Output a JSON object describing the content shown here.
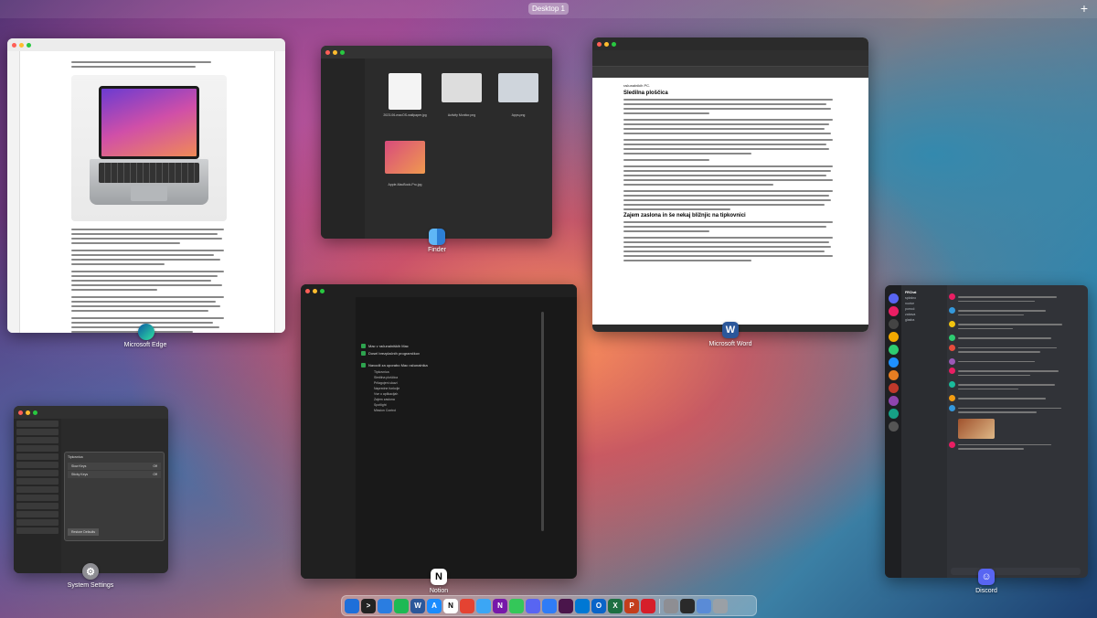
{
  "spaces": {
    "desktop_label": "Desktop 1",
    "add_symbol": "+"
  },
  "windows": {
    "edge": {
      "label": "Microsoft Edge",
      "icon": "edge-icon"
    },
    "finder": {
      "label": "Finder",
      "icon": "finder-icon",
      "files": [
        "2023-06-macOS-wallpaper.jpg",
        "Activity Monitor.png",
        "Apps.png",
        "Apple-MacBook-Pro.jpg"
      ]
    },
    "word": {
      "label": "Microsoft Word",
      "icon": "word-icon",
      "heading1": "Sledilna ploščica",
      "heading2": "Zajem zaslona in še nekaj bližnjic na tipkovnici",
      "heading1_prefix": "računalnikih PC."
    },
    "notion": {
      "label": "Notion",
      "icon": "notion-icon",
      "todos": [
        "Mac v računalniških Mac",
        "Dosel brezplačnih programčkov"
      ],
      "section": "Navodil za uporabo Mac računalnika",
      "bullets": [
        "Tipkovnica",
        "Sledilna ploščica",
        "Prilagojeni ukazi",
        "Napredne funkcije",
        "Vse o aplikacijah",
        "Zajem zaslona",
        "Spotlight",
        "Mission Control"
      ]
    },
    "settings": {
      "label": "System Settings",
      "icon": "gear-icon",
      "dialog_title": "Tipkovnica",
      "rows": [
        {
          "name": "Slow Keys",
          "value": "Off"
        },
        {
          "name": "Sticky Keys",
          "value": "Off"
        }
      ],
      "button_label": "Restore Defaults"
    },
    "discord": {
      "label": "Discord",
      "icon": "discord-icon",
      "server": "FRChat",
      "channels": [
        "splošno",
        "novice",
        "pomoč",
        "zabava",
        "glasba"
      ]
    }
  },
  "dock": {
    "apps": [
      {
        "name": "finder",
        "color": "#1e6fd9",
        "glyph": ""
      },
      {
        "name": "terminal",
        "color": "#222222",
        "glyph": ">"
      },
      {
        "name": "chrome",
        "color": "#2a7de1",
        "glyph": ""
      },
      {
        "name": "spotify",
        "color": "#1db954",
        "glyph": ""
      },
      {
        "name": "word",
        "color": "#2b579a",
        "glyph": "W"
      },
      {
        "name": "appstore",
        "color": "#1a8cff",
        "glyph": "A"
      },
      {
        "name": "notion",
        "color": "#ffffff",
        "glyph": "N"
      },
      {
        "name": "todoist",
        "color": "#e44332",
        "glyph": ""
      },
      {
        "name": "mail",
        "color": "#3ba6f5",
        "glyph": ""
      },
      {
        "name": "onenote",
        "color": "#7719aa",
        "glyph": "N"
      },
      {
        "name": "messages",
        "color": "#34c759",
        "glyph": ""
      },
      {
        "name": "discord",
        "color": "#5865f2",
        "glyph": ""
      },
      {
        "name": "messenger",
        "color": "#2f7cf6",
        "glyph": ""
      },
      {
        "name": "slack",
        "color": "#4a154b",
        "glyph": ""
      },
      {
        "name": "vscode",
        "color": "#0078d4",
        "glyph": ""
      },
      {
        "name": "outlook",
        "color": "#0a64c8",
        "glyph": "O"
      },
      {
        "name": "excel",
        "color": "#1d6f42",
        "glyph": "X"
      },
      {
        "name": "powerpoint",
        "color": "#c43e1c",
        "glyph": "P"
      },
      {
        "name": "todo",
        "color": "#d61e2a",
        "glyph": ""
      },
      {
        "name": "systemsettings",
        "color": "#8e8e93",
        "glyph": ""
      },
      {
        "name": "activitymonitor",
        "color": "#2a2a2a",
        "glyph": ""
      },
      {
        "name": "preview",
        "color": "#5a8bd6",
        "glyph": ""
      },
      {
        "name": "trash",
        "color": "#9aa0a6",
        "glyph": ""
      }
    ]
  }
}
